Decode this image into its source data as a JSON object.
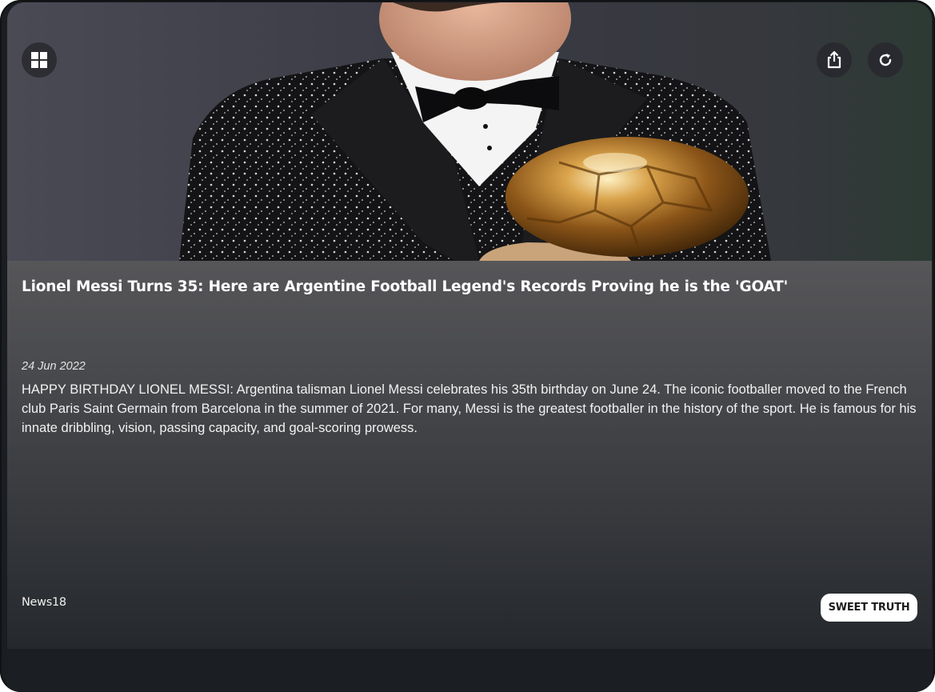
{
  "hero": {
    "image_subject": "Lionel Messi holding the Ballon d'Or trophy"
  },
  "toolbar": {
    "left_icon": "windows-grid-icon",
    "share_icon": "share-icon",
    "refresh_icon": "refresh-icon"
  },
  "article": {
    "title": "Lionel Messi Turns 35: Here are Argentine Football Legend's Records Proving he is the 'GOAT'",
    "date": "24 Jun 2022",
    "summary": "HAPPY BIRTHDAY LIONEL MESSI: Argentina talisman Lionel Messi celebrates his 35th birthday on June 24. The iconic footballer moved to the French club Paris Saint Germain from Barcelona in the summer of 2021. For many, Messi is the greatest footballer in the history of the sport. He is famous for his innate dribbling, vision, passing capacity, and goal-scoring prowess.",
    "source": "News18",
    "tag_label": "SWEET TRUTH"
  },
  "colors": {
    "frame_bg": "#1a1d21",
    "card_top": "#565659",
    "card_bottom": "#25282c",
    "tag_bg": "#ffffff"
  }
}
